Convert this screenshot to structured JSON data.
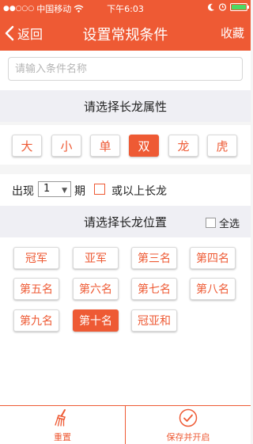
{
  "status_bar": {
    "signal": "●●○○○",
    "carrier": "中国移动",
    "time": "下午6:03",
    "battery_level": 1.0
  },
  "nav": {
    "back_label": "返回",
    "title": "设置常规条件",
    "right_label": "收藏"
  },
  "search": {
    "placeholder": "请输入条件名称",
    "value": ""
  },
  "attributes": {
    "header": "请选择长龙属性",
    "options": [
      "大",
      "小",
      "单",
      "双",
      "龙",
      "虎"
    ],
    "selected": "双"
  },
  "period": {
    "prefix": "出现",
    "value": "1",
    "suffix": "期",
    "checkbox_label": "或以上长龙",
    "checked": false
  },
  "positions": {
    "header": "请选择长龙位置",
    "select_all_label": "全选",
    "options": [
      "冠军",
      "亚军",
      "第三名",
      "第四名",
      "第五名",
      "第六名",
      "第七名",
      "第八名",
      "第九名",
      "第十名",
      "冠亚和"
    ],
    "selected": "第十名"
  },
  "toolbar": {
    "reset_label": "重置",
    "save_label": "保存并开启"
  },
  "colors": {
    "accent": "#ee5a34",
    "background": "#efeff4"
  }
}
